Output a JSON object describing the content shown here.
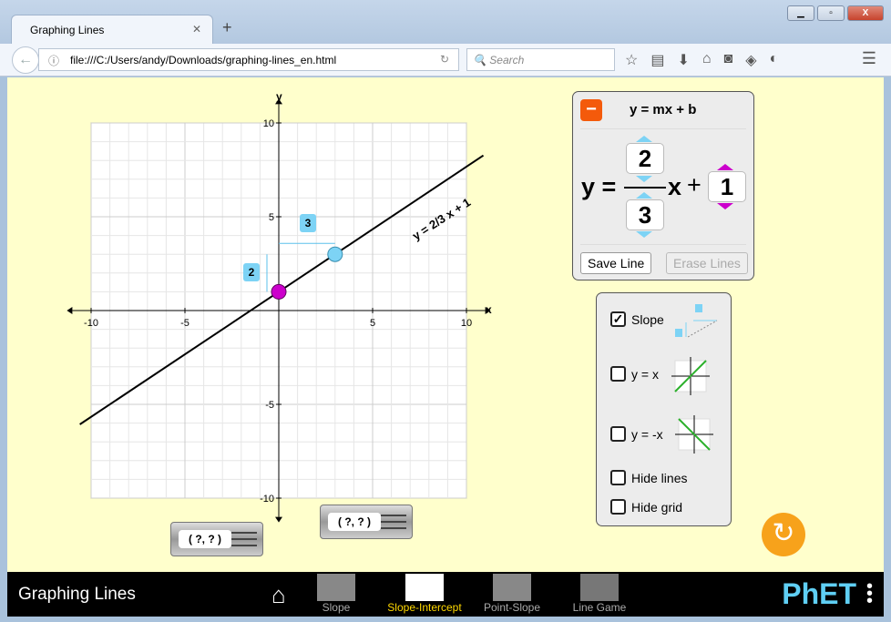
{
  "browser": {
    "tab_title": "Graphing Lines",
    "url": "file:///C:/Users/andy/Downloads/graphing-lines_en.html",
    "search_placeholder": "Search"
  },
  "equation": {
    "title": "y = mx + b",
    "y_label": "y =",
    "x_label": "x",
    "plus": "+",
    "rise": "2",
    "run": "3",
    "intercept": "1",
    "save_label": "Save Line",
    "erase_label": "Erase Lines"
  },
  "options": [
    {
      "label": "Slope",
      "checked": true
    },
    {
      "label": "y = x",
      "checked": false
    },
    {
      "label": "y = -x",
      "checked": false
    },
    {
      "label": "Hide lines",
      "checked": false
    },
    {
      "label": "Hide grid",
      "checked": false
    }
  ],
  "graph": {
    "x_range": [
      -10,
      10
    ],
    "y_range": [
      -10,
      10
    ],
    "x_axis_label": "x",
    "y_axis_label": "y",
    "ticks": [
      "-10",
      "-5",
      "5",
      "10"
    ],
    "slope": 0.6667,
    "intercept": 1,
    "line_label": "y = 2/3 x + 1",
    "rise_label": "2",
    "run_label": "3",
    "intercept_point": [
      0,
      1
    ],
    "slope_point": [
      3,
      3
    ],
    "line_color": "#000000",
    "intercept_point_color": "#cc00cc",
    "slope_point_color": "#7dd3f5"
  },
  "probes": [
    "( ?, ? )",
    "( ?, ? )"
  ],
  "footer": {
    "app_title": "Graphing Lines",
    "screens": [
      "Slope",
      "Slope-Intercept",
      "Point-Slope",
      "Line Game"
    ],
    "selected": "Slope-Intercept",
    "logo": "PhET"
  }
}
